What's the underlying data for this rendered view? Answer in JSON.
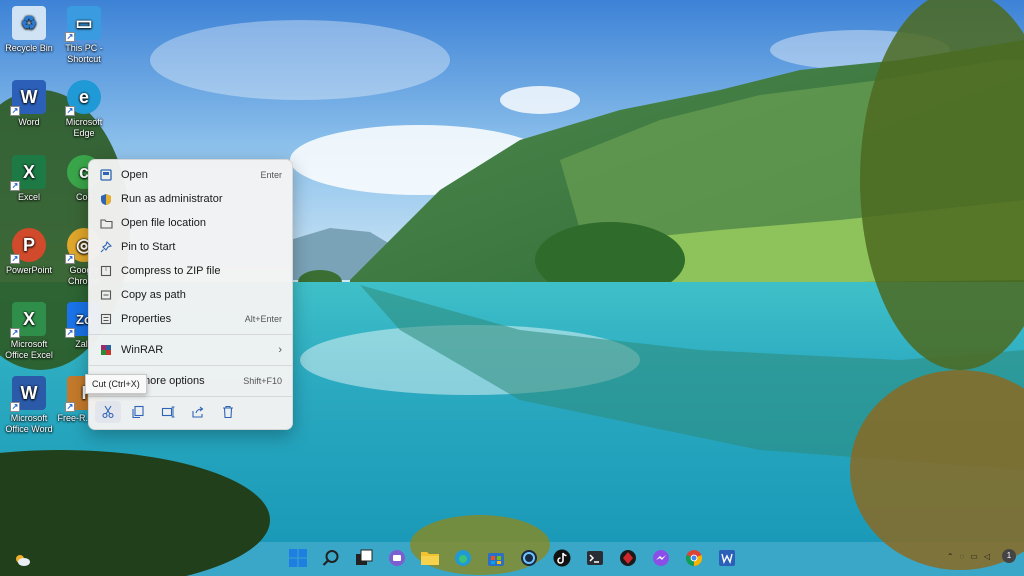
{
  "desktop": {
    "icons": [
      {
        "label": "Recycle Bin",
        "icon": "recycle-bin-icon",
        "color": "#7fb2e5"
      },
      {
        "label": "This PC - Shortcut",
        "icon": "monitor-icon",
        "color": "#3a9be0"
      },
      {
        "label": "Word",
        "icon": "word-icon",
        "color": "#2b5fb8",
        "glyph": "W"
      },
      {
        "label": "Microsoft Edge",
        "icon": "edge-icon",
        "color": "#1f9ad6",
        "glyph": "e"
      },
      {
        "label": "Excel",
        "icon": "excel-icon",
        "color": "#1d7a45",
        "glyph": "X"
      },
      {
        "label": "Coc",
        "icon": "coccoc-icon",
        "color": "#3aa64a",
        "glyph": "c"
      },
      {
        "label": "PowerPoint",
        "icon": "powerpoint-icon",
        "color": "#d04a2b",
        "glyph": "P"
      },
      {
        "label": "Google Chrome",
        "icon": "chrome-icon",
        "color": "#e0a72b",
        "glyph": "◎"
      },
      {
        "label": "Microsoft Office Excel",
        "icon": "office-excel-icon",
        "color": "#2f8f4a",
        "glyph": "X"
      },
      {
        "label": "Zalo",
        "icon": "zalo-icon",
        "color": "#1a73e8",
        "glyph": "Zo"
      },
      {
        "label": "Microsoft Office Word",
        "icon": "office-word-icon",
        "color": "#2a5aa8",
        "glyph": "W"
      },
      {
        "label": "Free-R... IDE",
        "icon": "ide-icon",
        "color": "#c47a2b",
        "glyph": "I"
      }
    ]
  },
  "context_menu": {
    "items": [
      {
        "label": "Open",
        "shortcut": "Enter",
        "icon": "open-icon"
      },
      {
        "label": "Run as administrator",
        "shortcut": "",
        "icon": "shield-icon"
      },
      {
        "label": "Open file location",
        "shortcut": "",
        "icon": "folder-icon"
      },
      {
        "label": "Pin to Start",
        "shortcut": "",
        "icon": "pin-icon"
      },
      {
        "label": "Compress to ZIP file",
        "shortcut": "",
        "icon": "zip-icon"
      },
      {
        "label": "Copy as path",
        "shortcut": "",
        "icon": "path-icon"
      },
      {
        "label": "Properties",
        "shortcut": "Alt+Enter",
        "icon": "properties-icon"
      }
    ],
    "winrar": {
      "label": "WinRAR",
      "icon": "winrar-icon"
    },
    "more": {
      "label": "more options",
      "shortcut": "Shift+F10"
    },
    "tooltip": "Cut (Ctrl+X)",
    "actions": [
      "cut-icon",
      "copy-icon",
      "rename-icon",
      "share-icon",
      "delete-icon"
    ]
  },
  "taskbar": {
    "apps": [
      "start-icon",
      "search-icon",
      "task-view-icon",
      "teams-icon",
      "file-explorer-icon",
      "edge-icon",
      "store-icon",
      "cortana-icon",
      "tiktok-icon",
      "terminal-icon",
      "game-icon",
      "messenger-icon",
      "chrome-icon",
      "word-icon"
    ],
    "notification_count": "1"
  }
}
